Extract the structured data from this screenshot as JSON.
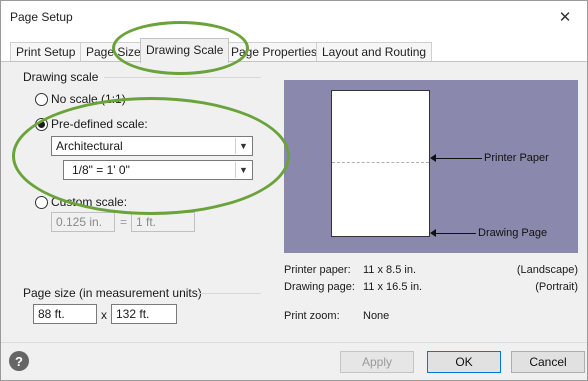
{
  "window": {
    "title": "Page Setup",
    "close_glyph": "✕"
  },
  "tabs": [
    {
      "label": "Print Setup"
    },
    {
      "label": "Page Size"
    },
    {
      "label": "Drawing Scale"
    },
    {
      "label": "Page Properties"
    },
    {
      "label": "Layout and Routing"
    }
  ],
  "drawing_scale": {
    "group_label": "Drawing scale",
    "no_scale_label": "No scale (1:1)",
    "predefined_label": "Pre-defined scale:",
    "predefined_category": "Architectural",
    "predefined_scale": "1/8\" = 1' 0\"",
    "custom_label": "Custom scale:",
    "custom_value_left": "0.125 in.",
    "equals": "=",
    "custom_value_right": "1 ft.",
    "selected": "predefined"
  },
  "page_size": {
    "group_label": "Page size (in measurement units)",
    "width": "88 ft.",
    "x_separator": "x",
    "height": "132 ft."
  },
  "preview": {
    "printer_paper_callout": "Printer Paper",
    "drawing_page_callout": "Drawing Page"
  },
  "info": {
    "printer_paper_label": "Printer paper:",
    "printer_paper_value": "11 x 8.5 in.",
    "printer_paper_orientation": "(Landscape)",
    "drawing_page_label": "Drawing page:",
    "drawing_page_value": "11 x 16.5 in.",
    "drawing_page_orientation": "(Portrait)",
    "print_zoom_label": "Print zoom:",
    "print_zoom_value": "None"
  },
  "buttons": {
    "help_glyph": "?",
    "apply": "Apply",
    "ok": "OK",
    "cancel": "Cancel"
  },
  "colors": {
    "preview_background": "#8a88ac",
    "annotation_green": "#6aa339"
  }
}
